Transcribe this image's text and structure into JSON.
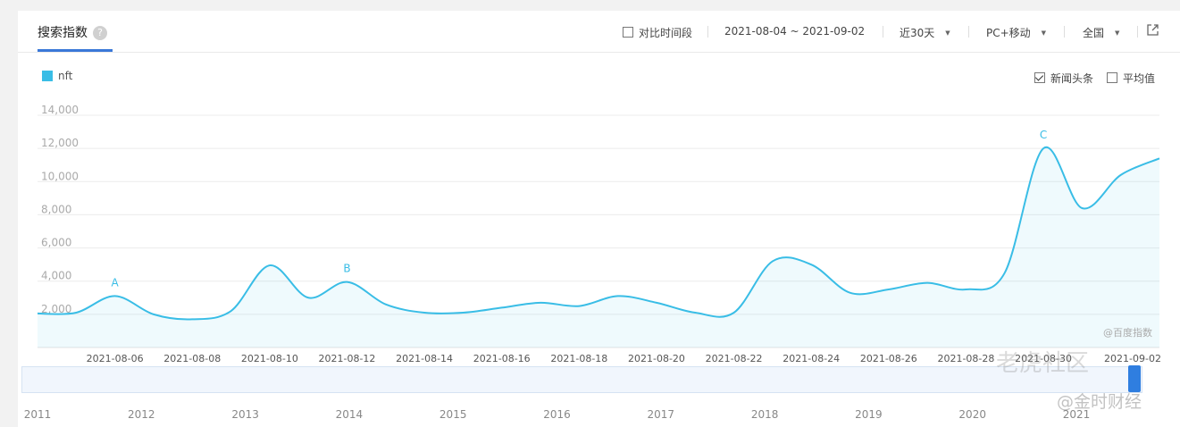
{
  "header": {
    "title": "搜索指数",
    "help_icon": "?",
    "compare_label": "对比时间段",
    "date_range": "2021-08-04 ~ 2021-09-02",
    "period": "近30天",
    "device": "PC+移动",
    "region": "全国"
  },
  "options": {
    "news_label": "新闻头条",
    "news_checked": true,
    "average_label": "平均值",
    "average_checked": false
  },
  "colors": {
    "accent": "#3a78d8",
    "series": "#39bde6"
  },
  "chart_data": {
    "type": "area",
    "title": "",
    "xlabel": "",
    "ylabel": "",
    "ylim": [
      0,
      14000
    ],
    "yticks": [
      "2,000",
      "4,000",
      "6,000",
      "8,000",
      "10,000",
      "12,000",
      "14,000"
    ],
    "x": [
      "2021-08-04",
      "2021-08-05",
      "2021-08-06",
      "2021-08-07",
      "2021-08-08",
      "2021-08-09",
      "2021-08-10",
      "2021-08-11",
      "2021-08-12",
      "2021-08-13",
      "2021-08-14",
      "2021-08-15",
      "2021-08-16",
      "2021-08-17",
      "2021-08-18",
      "2021-08-19",
      "2021-08-20",
      "2021-08-21",
      "2021-08-22",
      "2021-08-23",
      "2021-08-24",
      "2021-08-25",
      "2021-08-26",
      "2021-08-27",
      "2021-08-28",
      "2021-08-29",
      "2021-08-30",
      "2021-08-31",
      "2021-09-01",
      "2021-09-02"
    ],
    "xtick_labels": [
      "2021-08-06",
      "2021-08-08",
      "2021-08-10",
      "2021-08-12",
      "2021-08-14",
      "2021-08-16",
      "2021-08-18",
      "2021-08-20",
      "2021-08-22",
      "2021-08-24",
      "2021-08-26",
      "2021-08-28",
      "2021-08-30",
      "2021-09-02"
    ],
    "series": [
      {
        "name": "nft",
        "values": [
          2050,
          2100,
          3100,
          2000,
          1700,
          2200,
          4950,
          3000,
          3950,
          2600,
          2100,
          2100,
          2400,
          2700,
          2500,
          3100,
          2700,
          2100,
          2100,
          5200,
          5000,
          3300,
          3500,
          3900,
          3500,
          4500,
          12000,
          8400,
          10400,
          11400
        ]
      }
    ],
    "annotations": [
      {
        "label": "A",
        "x": "2021-08-06"
      },
      {
        "label": "B",
        "x": "2021-08-12"
      },
      {
        "label": "C",
        "x": "2021-08-30"
      }
    ],
    "source_watermark": "@百度指数",
    "grid": true,
    "legend": "top-left"
  },
  "overview": {
    "years": [
      "2011",
      "2012",
      "2013",
      "2014",
      "2015",
      "2016",
      "2017",
      "2018",
      "2019",
      "2020",
      "2021"
    ]
  },
  "watermarks": {
    "tiger": "老虎社区",
    "jinshi": "@金时财经"
  }
}
